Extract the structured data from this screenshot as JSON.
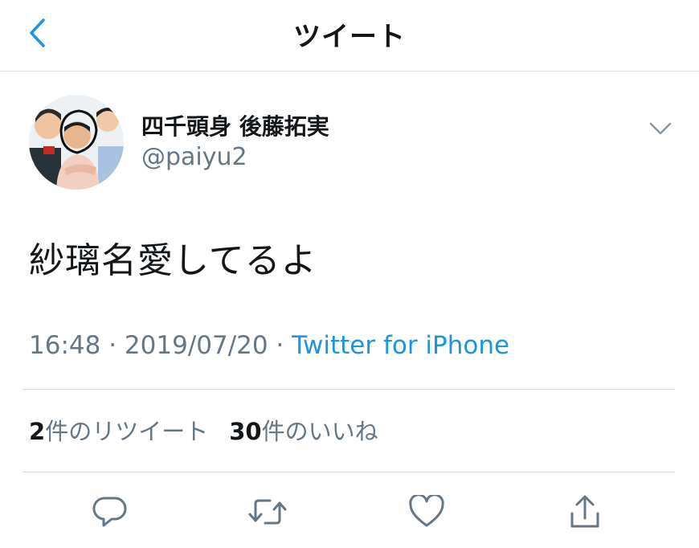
{
  "header": {
    "title": "ツイート",
    "back_icon": "chevron-left-icon",
    "accent_color": "#1b95e0"
  },
  "author": {
    "display_name": "四千頭身 後藤拓実",
    "username": "@paiyu2",
    "avatar_icon": "avatar-photo",
    "menu_icon": "chevron-down-icon"
  },
  "tweet": {
    "text": "紗璃名愛してるよ",
    "time": "16:48",
    "separator": "·",
    "date": "2019/07/20",
    "source": "Twitter for iPhone"
  },
  "stats": {
    "retweet_count": "2",
    "retweet_label": "件のリツイート",
    "like_count": "30",
    "like_label": "件のいいね"
  },
  "actions": [
    "reply-icon",
    "retweet-icon",
    "like-icon",
    "share-icon"
  ],
  "colors": {
    "text": "#14171a",
    "secondary": "#657786",
    "link": "#1b95e0",
    "divider": "#d9dee3"
  }
}
